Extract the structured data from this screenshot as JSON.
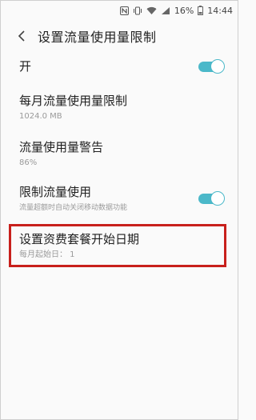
{
  "status_bar": {
    "nfc_icon": "nfc-icon",
    "vibrate_icon": "vibrate-icon",
    "wifi_icon": "wifi-icon",
    "signal_icon": "signal-icon",
    "battery_percent": "16%",
    "battery_icon": "battery-icon",
    "time": "14:44"
  },
  "header": {
    "back_icon": "back-arrow-icon",
    "title": "设置流量使用量限制"
  },
  "settings": {
    "main_switch": {
      "label": "开",
      "enabled": true
    },
    "monthly_limit": {
      "title": "每月流量使用量限制",
      "value": "1024.0 MB"
    },
    "usage_warning": {
      "title": "流量使用量警告",
      "value": "86%"
    },
    "limit_usage": {
      "title": "限制流量使用",
      "description": "流量超额时自动关闭移动数据功能",
      "enabled": true
    },
    "billing_start": {
      "title": "设置资费套餐开始日期",
      "value": "每月起始日： 1"
    }
  },
  "colors": {
    "toggle_accent": "#4bb8c9",
    "highlight_border": "#c8201c",
    "background": "#fafafa"
  }
}
